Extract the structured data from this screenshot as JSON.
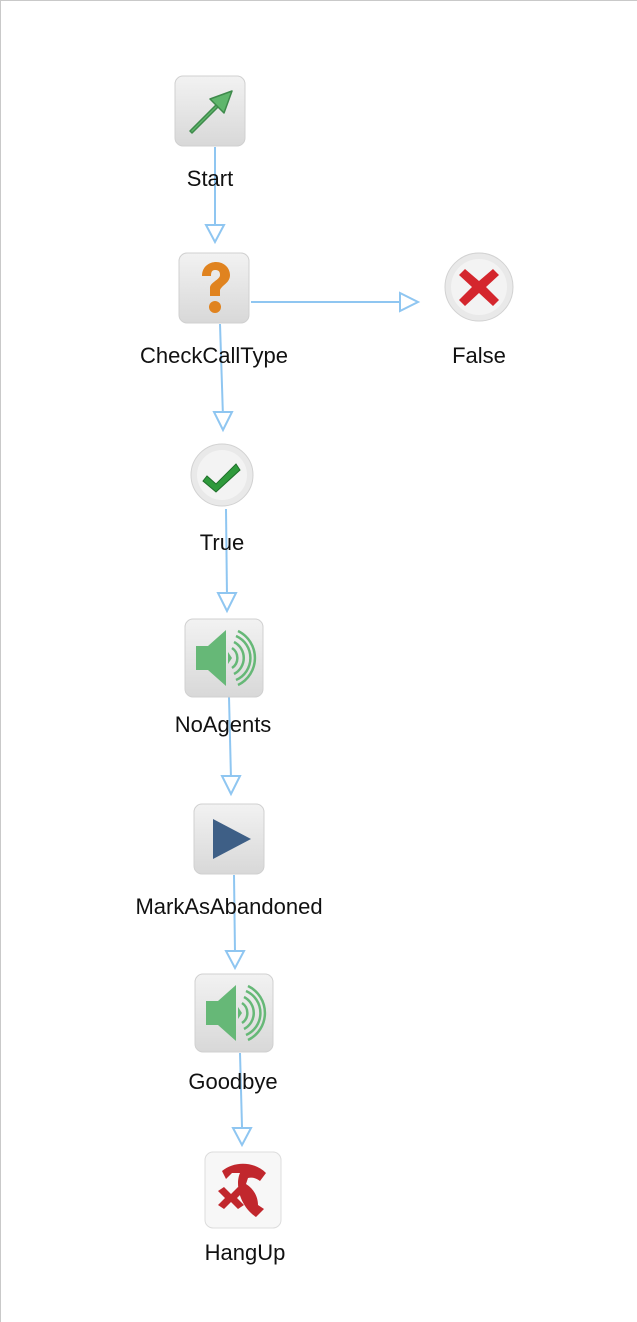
{
  "colors": {
    "connector": "#8fc6f1",
    "tile": "#e6e6e6",
    "start_arrow": "#5fb66c",
    "decision": "#e0831f",
    "false_x": "#d4262d",
    "true_check": "#2f9a3c",
    "speaker": "#66b877",
    "play": "#3e5f86",
    "hangup": "#c1272d"
  },
  "nodes": {
    "start": {
      "label": "Start",
      "icon": "start-arrow-icon"
    },
    "check_call_type": {
      "label": "CheckCallType",
      "icon": "question-mark-icon"
    },
    "false": {
      "label": "False",
      "icon": "red-x-icon"
    },
    "true": {
      "label": "True",
      "icon": "green-check-icon"
    },
    "no_agents": {
      "label": "NoAgents",
      "icon": "speaker-icon"
    },
    "mark_as_abandoned": {
      "label": "MarkAsAbandoned",
      "icon": "play-icon"
    },
    "goodbye": {
      "label": "Goodbye",
      "icon": "speaker-icon"
    },
    "hang_up": {
      "label": "HangUp",
      "icon": "hangup-phone-icon"
    }
  }
}
